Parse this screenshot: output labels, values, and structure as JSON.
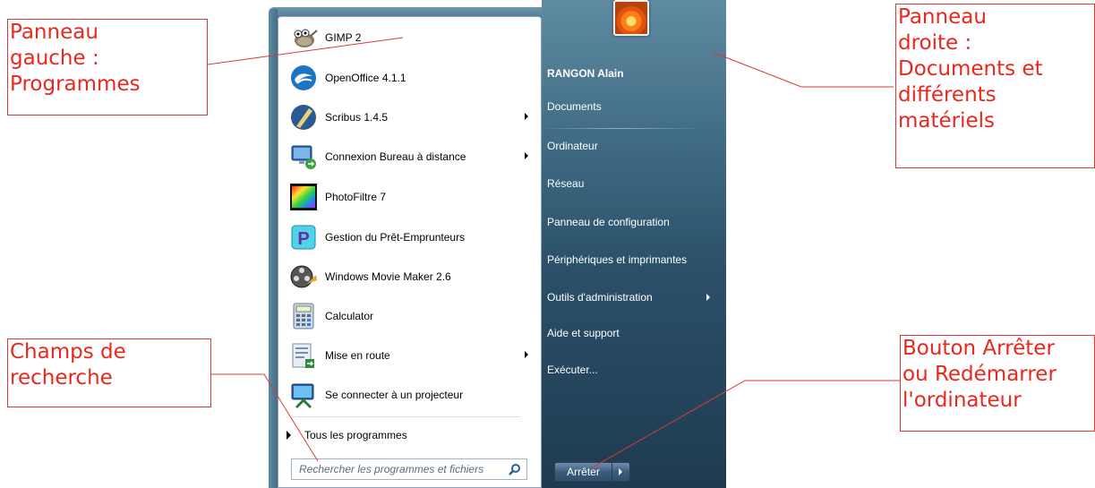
{
  "start_menu": {
    "programs": [
      {
        "label": "GIMP 2",
        "icon": "gimp-icon",
        "submenu": false
      },
      {
        "label": "OpenOffice 4.1.1",
        "icon": "openoffice-icon",
        "submenu": false
      },
      {
        "label": "Scribus 1.4.5",
        "icon": "scribus-icon",
        "submenu": true
      },
      {
        "label": "Connexion Bureau à distance",
        "icon": "remote-desktop-icon",
        "submenu": true
      },
      {
        "label": "PhotoFiltre 7",
        "icon": "photofiltre-icon",
        "submenu": false
      },
      {
        "label": "Gestion du Prêt-Emprunteurs",
        "icon": "pret-emprunteurs-icon",
        "submenu": false
      },
      {
        "label": "Windows Movie Maker 2.6",
        "icon": "movie-maker-icon",
        "submenu": false
      },
      {
        "label": "Calculator",
        "icon": "calculator-icon",
        "submenu": false
      },
      {
        "label": "Mise en route",
        "icon": "getting-started-icon",
        "submenu": true
      },
      {
        "label": "Se connecter à un projecteur",
        "icon": "projector-icon",
        "submenu": false
      }
    ],
    "all_programs": "Tous les programmes",
    "search_placeholder": "Rechercher les programmes et fichiers",
    "right_items": [
      {
        "label": "RANGON Alain",
        "submenu": false
      },
      {
        "label": "Documents",
        "submenu": false
      },
      {
        "label": "Ordinateur",
        "submenu": false
      },
      {
        "label": "Réseau",
        "submenu": false
      },
      {
        "label": "Panneau de configuration",
        "submenu": false
      },
      {
        "label": "Périphériques et imprimantes",
        "submenu": false
      },
      {
        "label": "Outils d'administration",
        "submenu": true
      },
      {
        "label": "Aide et support",
        "submenu": false
      },
      {
        "label": "Exécuter...",
        "submenu": false
      }
    ],
    "shutdown_label": "Arrêter"
  },
  "annotations": {
    "left_panel": [
      "Panneau",
      "gauche :",
      "Programmes"
    ],
    "right_panel": [
      "Panneau",
      "droite :",
      "Documents et",
      "différents",
      "matériels"
    ],
    "search": [
      "Champs de",
      "recherche"
    ],
    "shutdown": [
      "Bouton Arrêter",
      "ou Redémarrer",
      "l'ordinateur"
    ]
  },
  "colors": {
    "annotation_red": "#e8281f",
    "panel_blue": "#3f6a83"
  }
}
